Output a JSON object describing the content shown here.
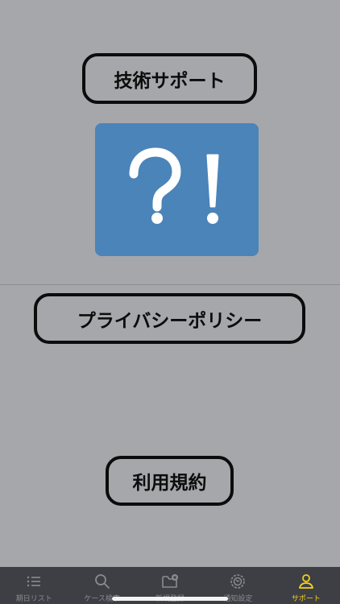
{
  "buttons": {
    "tech_support": "技術サポート",
    "privacy_policy": "プライバシーポリシー",
    "terms_of_use": "利用規約"
  },
  "image": {
    "icon": "question-exclamation-icon",
    "background": "#4a84b9"
  },
  "tabbar": {
    "active_color": "#f2d21c",
    "items": [
      {
        "label": "期日リスト",
        "icon": "list-icon",
        "active": false
      },
      {
        "label": "ケース検索",
        "icon": "search-icon",
        "active": false
      },
      {
        "label": "新規登録",
        "icon": "folder-add-icon",
        "active": false
      },
      {
        "label": "通知設定",
        "icon": "gear-icon",
        "active": false
      },
      {
        "label": "サポート",
        "icon": "person-icon",
        "active": true
      }
    ]
  }
}
